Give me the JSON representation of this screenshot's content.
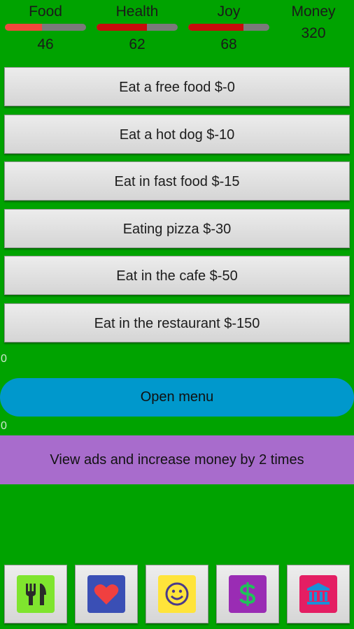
{
  "stats": [
    {
      "label": "Food",
      "value": "46",
      "level_percent": 46,
      "fill_color": "#f0483c"
    },
    {
      "label": "Health",
      "value": "62",
      "level_percent": 62,
      "fill_color": "#c80c0c"
    },
    {
      "label": "Joy",
      "value": "68",
      "level_percent": 68,
      "fill_color": "#c80c0c"
    }
  ],
  "money": {
    "label": "Money",
    "value": "320"
  },
  "actions": [
    {
      "label": "Eat a free food $-0"
    },
    {
      "label": "Eat a hot dog $-10"
    },
    {
      "label": "Eat in fast food $-15"
    },
    {
      "label": "Eating pizza $-30"
    },
    {
      "label": "Eat in the cafe $-50"
    },
    {
      "label": "Eat in the restaurant $-150"
    }
  ],
  "counter_top": "0",
  "open_menu_label": "Open menu",
  "counter_bottom": "0",
  "ads_label": "View ads and increase money by 2 times",
  "nav": [
    {
      "icon": "fork-knife-icon",
      "color": "#7fe52e"
    },
    {
      "icon": "heart-icon",
      "color": "#3a4fb5"
    },
    {
      "icon": "smiley-icon",
      "color": "#ffe43a"
    },
    {
      "icon": "dollar-icon",
      "color": "#9a2cb4"
    },
    {
      "icon": "bank-icon",
      "color": "#e41e63"
    }
  ],
  "colors": {
    "background": "#00a300",
    "open_menu": "#0098cc",
    "ads": "#a86ccc"
  }
}
